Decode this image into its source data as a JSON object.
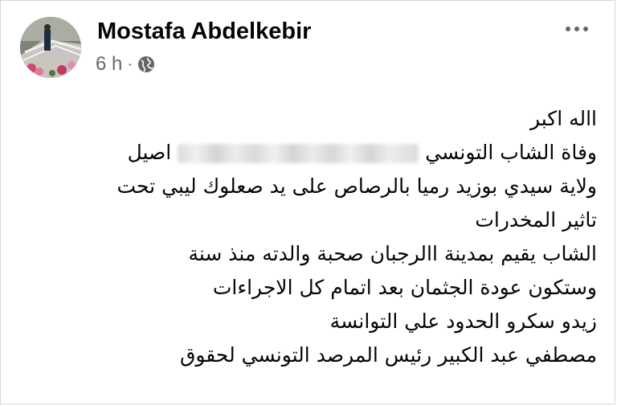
{
  "post": {
    "author": "Mostafa Abdelkebir",
    "time": "6 h",
    "separator": "·",
    "privacy_icon": "globe-icon",
    "more_icon": "more-options-icon",
    "lines": {
      "l1": "االه اكبر",
      "l2_start": "وفاة الشاب التونسي",
      "l2_end": "اصيل",
      "l3": "ولاية سيدي بوزيد رميا بالرصاص على يد صعلوك ليبي تحت",
      "l4": "تاثير المخدرات",
      "l5": "الشاب يقيم بمدينة االرجبان  صحبة والدته  منذ سنة",
      "l6": "وستكون عودة  الجثمان  بعد اتمام كل الاجراءات",
      "l7": "زيدو سكرو  الحدود علي التوانسة",
      "l8": "مصطفي عبد الكبير رئيس المرصد التونسي لحقوق"
    }
  },
  "colors": {
    "text": "#050505",
    "secondary_text": "#65676b",
    "border": "#d6d6d6"
  }
}
